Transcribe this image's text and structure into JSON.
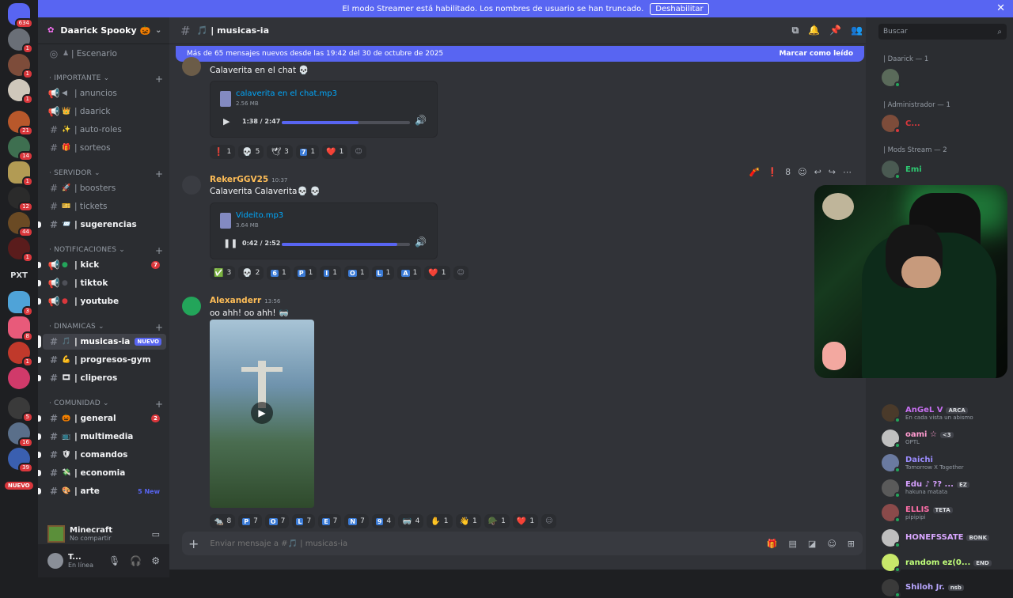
{
  "banner": {
    "text": "El modo Streamer está habilitado. Los nombres de usuario se han truncado.",
    "button": "Deshabilitar"
  },
  "servers": {
    "home_badge": "634",
    "badges": [
      "1",
      "1",
      "1",
      "",
      "21",
      "14",
      "1",
      "12",
      "44",
      "1",
      "",
      "3",
      "8",
      "1",
      "5",
      "",
      "16",
      "39"
    ],
    "nuevo": "NUEVO",
    "pxt": "PXT"
  },
  "guild": {
    "name": "Daarick Spooky 🎃"
  },
  "channels": {
    "stage": "| Escenario",
    "cat_importante": "IMPORTANTE",
    "anuncios": "| anuncios",
    "daarick": "| daarick",
    "autoroles": "| auto-roles",
    "sorteos": "| sorteos",
    "cat_servidor": "SERVIDOR",
    "boosters": "| boosters",
    "tickets": "| tickets",
    "sugerencias": "| sugerencias",
    "cat_notificaciones": "NOTIFICACIONES",
    "kick": "| kick",
    "kick_count": "7",
    "tiktok": "| tiktok",
    "youtube": "| youtube",
    "cat_dinamicas": "DINAMICAS",
    "musicas": "| musicas-ia",
    "musicas_badge": "NUEVO",
    "progresos": "| progresos-gym",
    "clipers": "| cliperos",
    "cat_comunidad": "COMUNIDAD",
    "general": "| general",
    "general_count": "2",
    "multimedia": "| multimedia",
    "comandos": "| comandos",
    "economia": "| economia",
    "arte": "| arte",
    "arte_new": "5 New"
  },
  "activity": {
    "title": "Minecraft",
    "sub": "No compartir"
  },
  "user": {
    "name": "T...",
    "status": "En línea"
  },
  "header": {
    "channel": "| musicas-ia"
  },
  "newbar": {
    "text": "Más de 65 mensajes nuevos desde las 19:42 del 30 de octubre de 2025",
    "mark": "Marcar como leído"
  },
  "messages": {
    "m1": {
      "text": "Calaverita en el chat 💀",
      "file": "calaverita en el chat.mp3",
      "size": "2.56 MB",
      "time": "1:38 / 2:47",
      "progress": 0.6,
      "reactions": [
        [
          "❗",
          "1"
        ],
        [
          "💀",
          "5"
        ],
        [
          "🕊",
          "3"
        ],
        [
          "7",
          "1"
        ],
        [
          "❤️",
          "1"
        ]
      ]
    },
    "m2": {
      "author": "RekerGGV25",
      "ts": "10:37",
      "text": "Calaverita Calaverita💀 💀",
      "file": "Videito.mp3",
      "size": "3.64 MB",
      "time": "0:42 / 2:52",
      "progress": 0.9,
      "reactions": [
        [
          "✅",
          "3"
        ],
        [
          "💀",
          "2"
        ],
        [
          "6",
          "1"
        ],
        [
          "P",
          "1"
        ],
        [
          "I",
          "1"
        ],
        [
          "O",
          "1"
        ],
        [
          "L",
          "1"
        ],
        [
          "A",
          "1"
        ],
        [
          "❤️",
          "1"
        ]
      ]
    },
    "m3": {
      "author": "Alexanderr",
      "ts": "13:56",
      "text": "oo ahh! oo ahh! 🥽",
      "reactions": [
        [
          "🐀",
          "8"
        ],
        [
          "P",
          "7"
        ],
        [
          "O",
          "7"
        ],
        [
          "L",
          "7"
        ],
        [
          "E",
          "7"
        ],
        [
          "N",
          "7"
        ],
        [
          "9",
          "4"
        ],
        [
          "🥽",
          "4"
        ],
        [
          "✋",
          "1"
        ],
        [
          "👋",
          "1"
        ],
        [
          "🪖",
          "1"
        ],
        [
          "❤️",
          "1"
        ]
      ]
    }
  },
  "composer": {
    "placeholder": "Enviar mensaje a #🎵 | musicas-ia"
  },
  "members": {
    "search": "Buscar",
    "role1": "| Daarick — 1",
    "role2": "| Administrador — 1",
    "admin": "C...",
    "role3": "| Mods Stream — 2",
    "mod": "Emi",
    "list": [
      {
        "name": "AnGeL V",
        "tag": "ARCA",
        "status": "En cada vista un abismo"
      },
      {
        "name": "oami ☆",
        "tag": "<3",
        "status": "OPTL"
      },
      {
        "name": "Daichi",
        "tag": "",
        "status": "Tomorrow X Together"
      },
      {
        "name": "Edu ♪ ?? ...",
        "tag": "EZ",
        "status": "hakuna matata"
      },
      {
        "name": "ELLIS",
        "tag": "TETA",
        "status": "pipipipi"
      },
      {
        "name": "HONEFSSATE",
        "tag": "BONK",
        "status": ""
      },
      {
        "name": "random ez(0...",
        "tag": "END",
        "status": ""
      },
      {
        "name": "Shiloh Jr.",
        "tag": "nsb",
        "status": ""
      }
    ]
  },
  "colors": {
    "accent": "#5865f2",
    "danger": "#da373c",
    "author": "#ffbe57",
    "link": "#00a8fc"
  }
}
